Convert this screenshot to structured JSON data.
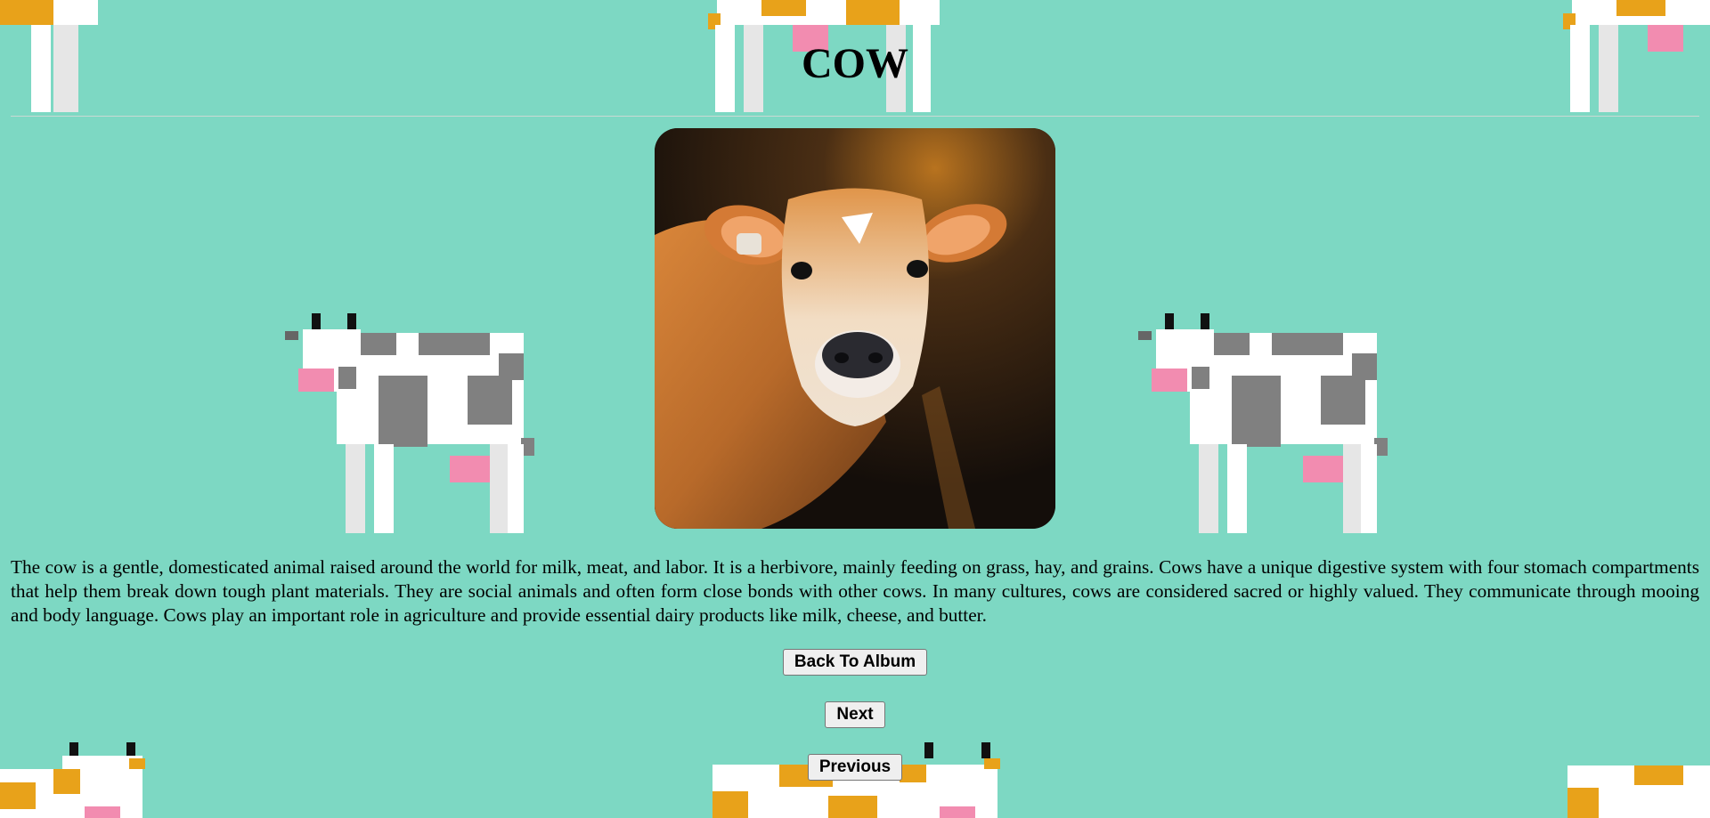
{
  "page": {
    "title": "COW",
    "description": "The cow is a gentle, domesticated animal raised around the world for milk, meat, and labor. It is a herbivore, mainly feeding on grass, hay, and grains. Cows have a unique digestive system with four stomach compartments that help them break down tough plant materials. They are social animals and often form close bonds with other cows. In many cultures, cows are considered sacred or highly valued. They communicate through mooing and body language. Cows play an important role in agriculture and provide essential dairy products like milk, cheese, and butter."
  },
  "buttons": {
    "back_label": "Back To Album",
    "next_label": "Next",
    "previous_label": "Previous"
  },
  "colors": {
    "background": "#7dd8c3",
    "cow_spots_gray": "#808080",
    "cow_spots_gold": "#e8a21a",
    "cow_udder_pink": "#f28cb0"
  },
  "icons": {
    "background_pattern": "pixel-cow-icon",
    "photo": "cow-photo"
  }
}
